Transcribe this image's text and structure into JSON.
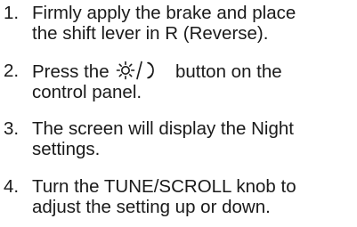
{
  "steps": [
    {
      "number": "1.",
      "line1": "Firmly apply the brake and place",
      "line2": "the shift lever in R (Reverse)."
    },
    {
      "number": "2.",
      "text_before_icon": "Press the ",
      "icon": "sun-moon-icon",
      "text_after_icon": " button on the",
      "line2": "control panel."
    },
    {
      "number": "3.",
      "line1": "The screen will display the Night",
      "line2": "settings."
    },
    {
      "number": "4.",
      "line1": "Turn the TUNE/SCROLL knob to",
      "line2": "adjust the setting up or down."
    }
  ]
}
